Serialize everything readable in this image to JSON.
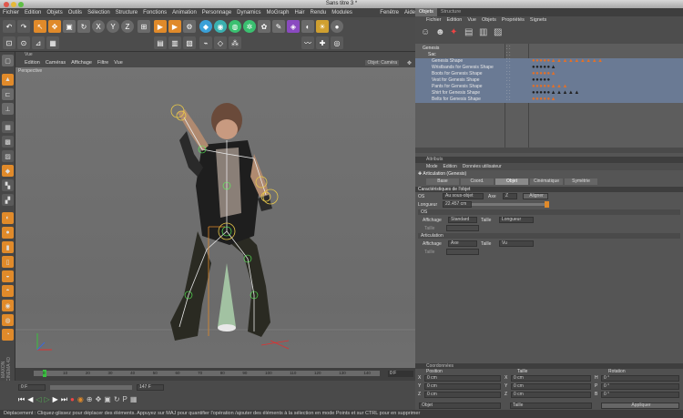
{
  "window": {
    "title": "Sans titre 3 *"
  },
  "menu": [
    "Fichier",
    "Edition",
    "Objets",
    "Outils",
    "Sélection",
    "Structure",
    "Fonctions",
    "Animation",
    "Personnage",
    "Dynamics",
    "MoGraph",
    "Hair",
    "Rendu",
    "Modules externes",
    "Fenêtre",
    "Aide"
  ],
  "viewport": {
    "menu": [
      "Edition",
      "Caméras",
      "Affichage",
      "Filtre",
      "Vue"
    ],
    "label": "Perspective",
    "title_small": "Vue",
    "right_label": "Objet: Caméra"
  },
  "timeline": {
    "ticks": [
      "0",
      "10",
      "20",
      "30",
      "40",
      "50",
      "60",
      "70",
      "80",
      "90",
      "100",
      "110",
      "120",
      "130",
      "140"
    ],
    "frame_value": "0 F",
    "end_value": "147 F",
    "start_value": "0 F"
  },
  "objects_panel": {
    "tabs": [
      "Objets",
      "Structure"
    ],
    "menu": [
      "Fichier",
      "Edition",
      "Vue",
      "Objets",
      "Propriétés",
      "Signets"
    ],
    "items": [
      "Genesis",
      "Sac",
      "Genesis Shape",
      "Wristbands for Genesis Shape",
      "Boots for Genesis Shape",
      "Vest for Genesis Shape",
      "Pants for Genesis Shape",
      "Shirt for Genesis Shape",
      "Belts for Genesis Shape"
    ]
  },
  "attributes": {
    "header": "Attributs",
    "menu": [
      "Mode",
      "Edition",
      "Données utilisateur"
    ],
    "object_name": "Articulation (Genesis)",
    "tabs": [
      "Base",
      "Coord.",
      "Objet",
      "Cinématique",
      "Symétrie"
    ],
    "active_tab": "Objet",
    "section_title": "Caractéristiques de l'objet",
    "os_label": "OS",
    "os_value": "Au sous-objet",
    "axe_label": "Axe",
    "axe_value": "Z",
    "align_button": "Aligner",
    "longueur_label": "Longueur",
    "longueur_value": "22.457 cm",
    "os_sub_title": "OS",
    "affichage_label": "Affichage",
    "affichage_value": "Standard",
    "taille_label": "Taille",
    "taille_value": "Longueur",
    "taille2_label": "Taille",
    "articulation_title": "Articulation",
    "affichage2_label": "Affichage",
    "affichage2_value": "Axe",
    "taille3_label": "Taille",
    "taille3_value": "Vu",
    "taille4_label": "Taille"
  },
  "coordinates": {
    "header": "Coordonnées",
    "cols": [
      "Position",
      "Taille",
      "Rotation"
    ],
    "rows": [
      {
        "axis": "X",
        "pos": "0 cm",
        "size": "0 cm",
        "rot_axis": "H",
        "rot": "0 °"
      },
      {
        "axis": "Y",
        "pos": "0 cm",
        "size": "0 cm",
        "rot_axis": "P",
        "rot": "0 °"
      },
      {
        "axis": "Z",
        "pos": "0 cm",
        "size": "0 cm",
        "rot_axis": "B",
        "rot": "0 °"
      }
    ],
    "mode_left": "Objet",
    "mode_mid": "Taille",
    "apply_button": "Appliquer"
  },
  "status": "Déplacement : Cliquez-glissez pour déplacer des éléments. Appuyez sur MAJ pour quantifier l'opération /ajouter des éléments à la sélection en mode Points et sur CTRL pour en supprimer",
  "brand": "MAXON CINEMA 4D",
  "colors": {
    "accent": "#e07b20",
    "selected": "#6a7a94",
    "panel": "#555555"
  }
}
